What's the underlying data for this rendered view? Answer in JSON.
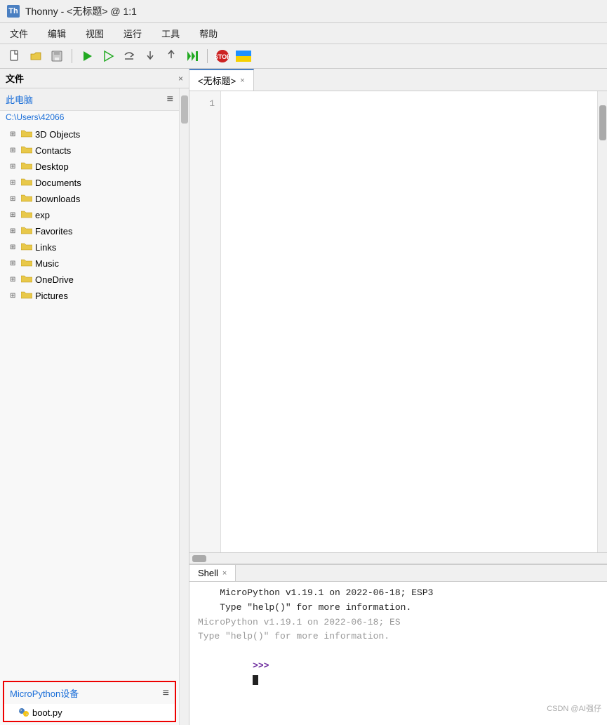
{
  "titleBar": {
    "appIcon": "Th",
    "title": "Thonny - <无标题> @ 1:1"
  },
  "menuBar": {
    "items": [
      "文件",
      "编辑",
      "视图",
      "运行",
      "工具",
      "帮助"
    ]
  },
  "toolbar": {
    "buttons": [
      {
        "name": "new-file",
        "icon": "📄"
      },
      {
        "name": "open-file",
        "icon": "📂"
      },
      {
        "name": "save-file",
        "icon": "💾"
      },
      {
        "name": "run",
        "icon": "▶"
      },
      {
        "name": "debug",
        "icon": "🐛"
      },
      {
        "name": "step-over",
        "icon": "↷"
      },
      {
        "name": "step-into",
        "icon": "↴"
      },
      {
        "name": "step-out",
        "icon": "↑"
      },
      {
        "name": "resume",
        "icon": "⏩"
      },
      {
        "name": "stop",
        "icon": "⛔"
      },
      {
        "name": "flag",
        "icon": "🟨"
      }
    ]
  },
  "filePanel": {
    "title": "文件",
    "thisPC": {
      "label": "此电脑",
      "path": "C:\\Users\\42066"
    },
    "folders": [
      {
        "name": "3D Objects",
        "expanded": false
      },
      {
        "name": "Contacts",
        "expanded": false
      },
      {
        "name": "Desktop",
        "expanded": false
      },
      {
        "name": "Documents",
        "expanded": false
      },
      {
        "name": "Downloads",
        "expanded": false
      },
      {
        "name": "exp",
        "expanded": false
      },
      {
        "name": "Favorites",
        "expanded": false
      },
      {
        "name": "Links",
        "expanded": false
      },
      {
        "name": "Music",
        "expanded": false
      },
      {
        "name": "OneDrive",
        "expanded": false
      },
      {
        "name": "Pictures",
        "expanded": false
      }
    ],
    "microPython": {
      "title": "MicroPython设备",
      "files": [
        {
          "name": "boot.py",
          "type": "python"
        }
      ]
    }
  },
  "editor": {
    "tabs": [
      {
        "label": "<无标题>",
        "active": true
      }
    ],
    "lineNumbers": [
      1
    ],
    "content": ""
  },
  "shell": {
    "tabLabel": "Shell",
    "lines": [
      {
        "text": "MicroPython v1.19.1 on 2022-06-18; ESP3",
        "style": "dark"
      },
      {
        "text": "Type \"help()\" for more information.",
        "style": "dark"
      },
      {
        "text": "MicroPython v1.19.1 on 2022-06-18; ES",
        "style": "gray"
      },
      {
        "text": "Type \"help()\" for more information.",
        "style": "gray"
      }
    ],
    "prompt": ">>>"
  },
  "watermark": "CSDN @AI强仔"
}
